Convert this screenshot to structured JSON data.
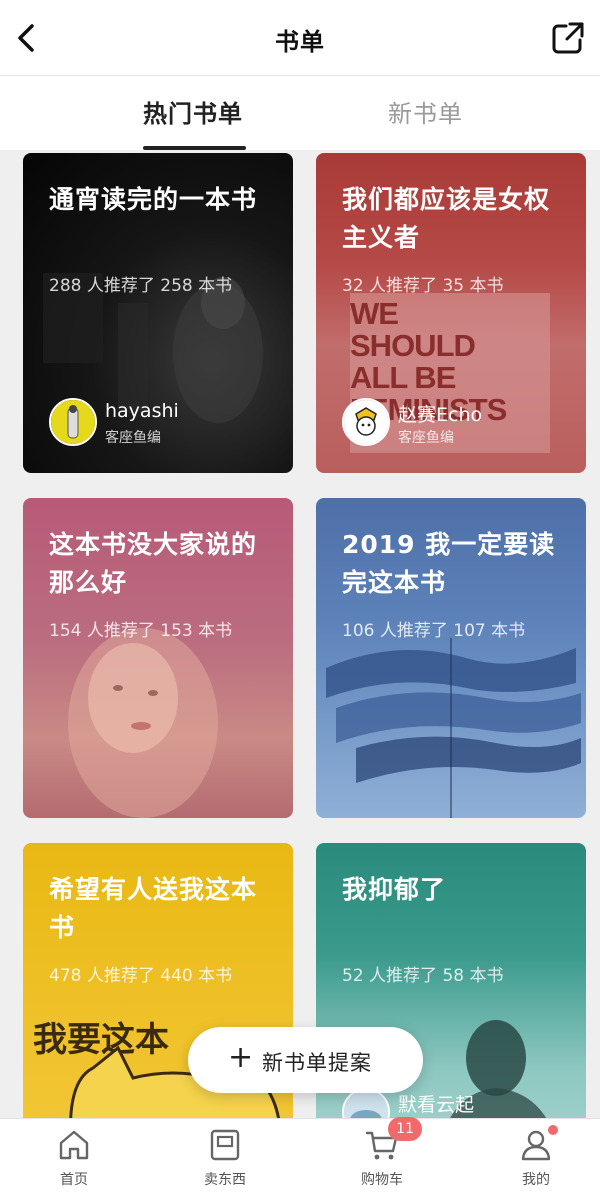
{
  "header": {
    "title": "书单"
  },
  "tabs": [
    {
      "label": "热门书单",
      "active": true
    },
    {
      "label": "新书单",
      "active": false
    }
  ],
  "cards": [
    {
      "title": "通宵读完的一本书",
      "stats": "288 人推荐了 258 本书",
      "author": "hayashi",
      "role": "客座鱼编"
    },
    {
      "title": "我们都应该是女权主义者",
      "stats": "32 人推荐了 35 本书",
      "author": "赵赛Echo",
      "role": "客座鱼编",
      "poster_lines": [
        "WE",
        "SHOULD",
        "ALL BE",
        "FEMINISTS"
      ]
    },
    {
      "title": "这本书没大家说的那么好",
      "stats": "154 人推荐了 153 本书"
    },
    {
      "title": "2019 我一定要读完这本书",
      "stats": "106 人推荐了 107 本书"
    },
    {
      "title": "希望有人送我这本书",
      "stats": "478 人推荐了 440 本书",
      "image_text": "我要这本"
    },
    {
      "title": "我抑郁了",
      "stats": "52 人推荐了 58 本书",
      "author": "默看云起"
    }
  ],
  "fab": {
    "plus": "+",
    "label": "新书单提案"
  },
  "nav": [
    {
      "label": "首页",
      "icon": "home-icon"
    },
    {
      "label": "卖东西",
      "icon": "sell-icon"
    },
    {
      "label": "购物车",
      "icon": "cart-icon",
      "badge": "11"
    },
    {
      "label": "我的",
      "icon": "profile-icon",
      "dot": true
    }
  ],
  "colors": {
    "badge": "#f06a6a",
    "accent": "#222222"
  }
}
